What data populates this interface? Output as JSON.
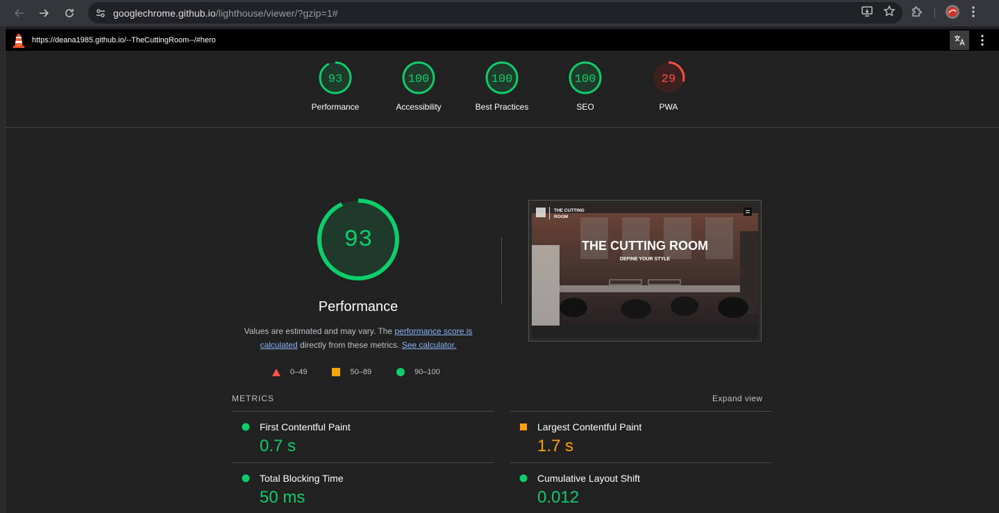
{
  "browser": {
    "url_host": "googlechrome.github.io",
    "url_path": "/lighthouse/viewer/?gzip=1#"
  },
  "lighthouse_bar": {
    "report_url": "https://deana1985.github.io/--TheCuttingRoom--/#hero"
  },
  "categories": [
    {
      "label": "Performance",
      "score": "93",
      "fraction": 0.93,
      "color": "#0cce6b"
    },
    {
      "label": "Accessibility",
      "score": "100",
      "fraction": 1.0,
      "color": "#0cce6b"
    },
    {
      "label": "Best Practices",
      "score": "100",
      "fraction": 1.0,
      "color": "#0cce6b"
    },
    {
      "label": "SEO",
      "score": "100",
      "fraction": 1.0,
      "color": "#0cce6b"
    },
    {
      "label": "PWA",
      "score": "29",
      "fraction": 0.29,
      "color": "#ff4e42"
    }
  ],
  "performance": {
    "score": "93",
    "fraction": 0.93,
    "title": "Performance",
    "desc_prefix": "Values are estimated and may vary. The ",
    "desc_link": "performance score is calculated",
    "desc_mid": " directly from these metrics. ",
    "desc_link2": "See calculator.",
    "legend": [
      "0–49",
      "50–89",
      "90–100"
    ]
  },
  "screenshot": {
    "brand_line1": "THE CUTTING",
    "brand_line2": "ROOM",
    "headline": "THE CUTTING ROOM",
    "subheadline": "DEFINE YOUR STYLE"
  },
  "metrics": {
    "heading": "METRICS",
    "expand": "Expand view",
    "items": [
      {
        "name": "First Contentful Paint",
        "value": "0.7 s",
        "status": "pass",
        "color": "#0cce6b"
      },
      {
        "name": "Largest Contentful Paint",
        "value": "1.7 s",
        "status": "average",
        "color": "#ffa400"
      },
      {
        "name": "Total Blocking Time",
        "value": "50 ms",
        "status": "pass",
        "color": "#0cce6b"
      },
      {
        "name": "Cumulative Layout Shift",
        "value": "0.012",
        "status": "pass",
        "color": "#0cce6b"
      }
    ]
  },
  "colors": {
    "pass": "#0cce6b",
    "average": "#ffa400",
    "fail": "#ff4e42"
  }
}
